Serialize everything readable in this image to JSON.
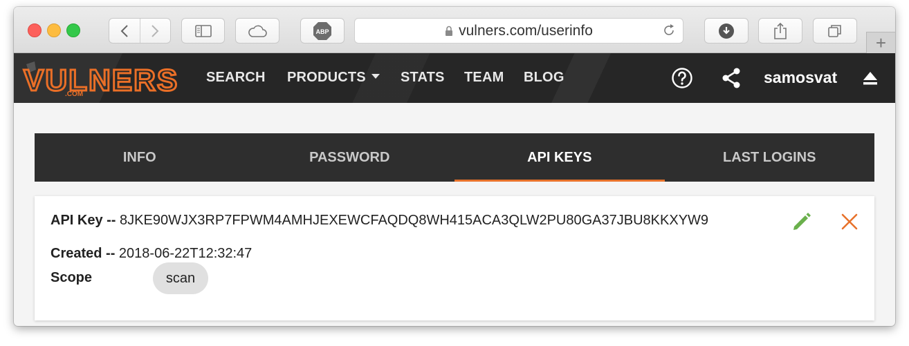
{
  "browser": {
    "url": "vulners.com/userinfo",
    "new_tab_label": "+",
    "adblock_label": "ABP"
  },
  "site": {
    "logo_text": "VULNERS",
    "logo_sub": ".COM",
    "nav": [
      "SEARCH",
      "PRODUCTS",
      "STATS",
      "TEAM",
      "BLOG"
    ],
    "username": "samosvat"
  },
  "tabs": [
    {
      "label": "INFO",
      "active": false
    },
    {
      "label": "PASSWORD",
      "active": false
    },
    {
      "label": "API KEYS",
      "active": true
    },
    {
      "label": "LAST LOGINS",
      "active": false
    }
  ],
  "api_key": {
    "key_label": "API Key --",
    "key_value": "8JKE90WJX3RP7FPWM4AMHJEXEWCFAQDQ8WH415ACA3QLW2PU80GA37JBU8KKXYW9",
    "created_label": "Created --",
    "created_value": "2018-06-22T12:32:47",
    "scope_label": "Scope",
    "scope_value": "scan"
  },
  "colors": {
    "accent": "#e8722b",
    "edit_icon": "#6ab04c",
    "delete_icon": "#e8722b",
    "header_bg": "#262626"
  }
}
